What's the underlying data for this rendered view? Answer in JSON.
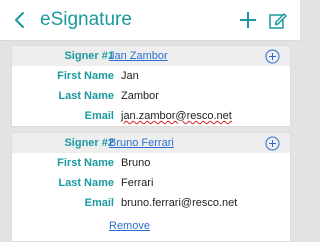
{
  "header": {
    "title": "eSignature"
  },
  "signers": [
    {
      "label": "Signer #1",
      "name_link": "Jan Zambor",
      "fields": [
        {
          "label": "First Name",
          "value": "Jan"
        },
        {
          "label": "Last Name",
          "value": "Zambor"
        },
        {
          "label": "Email",
          "value": "jan.zambor@resco.net"
        }
      ]
    },
    {
      "label": "Signer #2",
      "name_link": "Bruno Ferrari",
      "fields": [
        {
          "label": "First Name",
          "value": "Bruno"
        },
        {
          "label": "Last Name",
          "value": "Ferrari"
        },
        {
          "label": "Email",
          "value": "bruno.ferrari@resco.net"
        }
      ],
      "remove_label": "Remove"
    }
  ],
  "colors": {
    "accent": "#1a9aa0",
    "link": "#2d6fd0",
    "background": "#e3e3e3"
  }
}
